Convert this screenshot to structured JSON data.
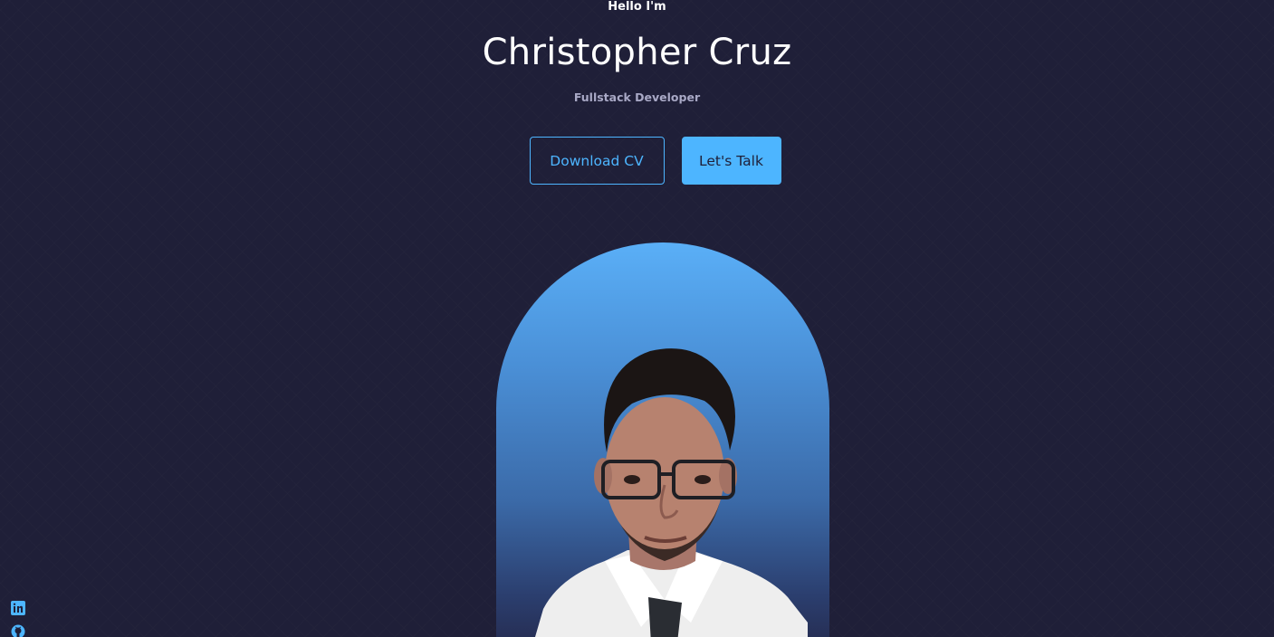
{
  "header": {
    "greeting": "Hello I'm",
    "name": "Christopher Cruz",
    "role": "Fullstack Developer"
  },
  "cta": {
    "download_label": "Download CV",
    "talk_label": "Let's Talk"
  },
  "socials": [
    {
      "icon": "linkedin-icon"
    },
    {
      "icon": "github-icon"
    }
  ],
  "colors": {
    "background": "#1f1f38",
    "accent": "#4db5ff",
    "muted_text": "#a9a9c6"
  }
}
